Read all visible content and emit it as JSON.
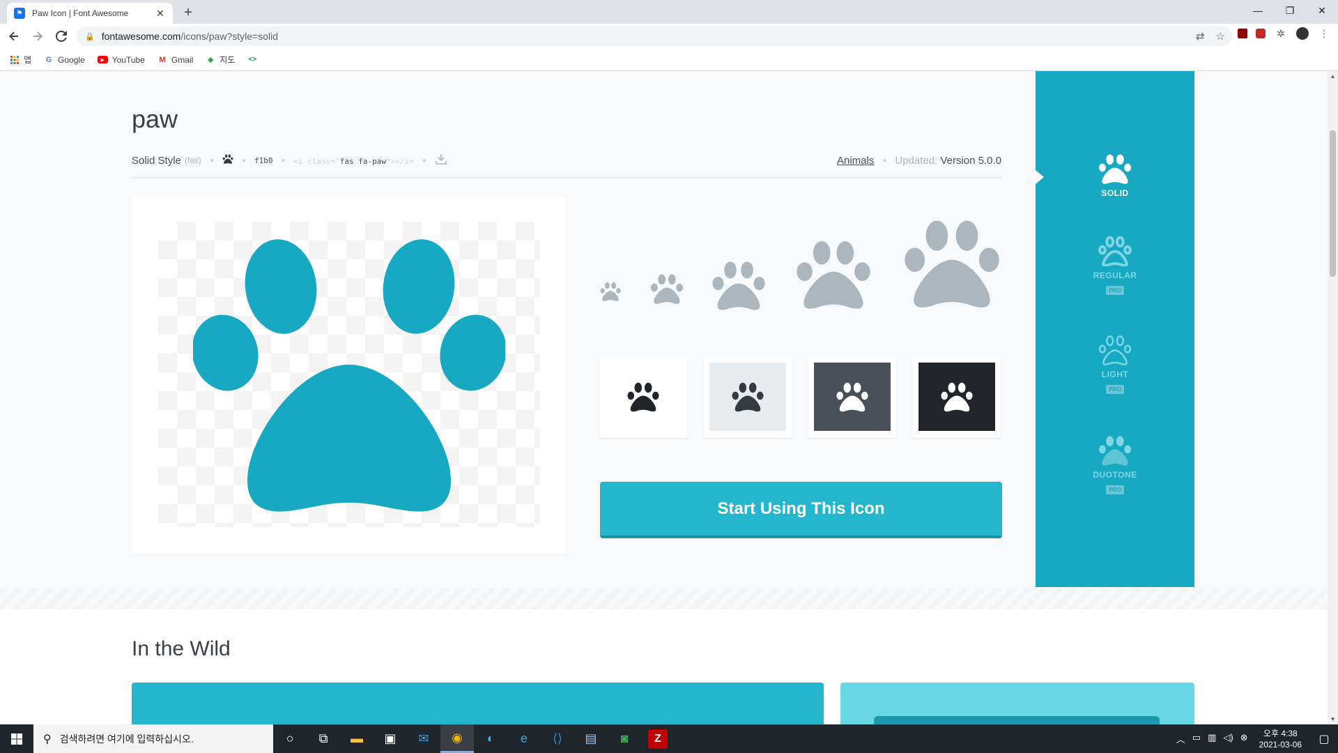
{
  "browser": {
    "tab_title": "Paw Icon | Font Awesome",
    "tab_close": "✕",
    "new_tab": "+",
    "url_host": "fontawesome.com",
    "url_path": "/icons/paw?style=solid",
    "window_controls": {
      "minimize": "—",
      "restore": "❐",
      "close": "✕"
    }
  },
  "bookmarks": [
    {
      "label": "앱",
      "icon": "apps-grid-icon"
    },
    {
      "label": "Google",
      "icon": "google-icon"
    },
    {
      "label": "YouTube",
      "icon": "youtube-icon"
    },
    {
      "label": "Gmail",
      "icon": "gmail-icon"
    },
    {
      "label": "지도",
      "icon": "maps-icon"
    },
    {
      "label": "",
      "icon": "code-icon"
    }
  ],
  "icon_page": {
    "name": "paw",
    "style_label": "Solid Style",
    "style_prefix": "(fas)",
    "unicode": "f1b0",
    "code_open": "<i class=\"",
    "code_class": "fas fa-paw",
    "code_close": "\"></i>",
    "category": "Animals",
    "updated_label": "Updated:",
    "version": "Version 5.0.0",
    "start_button": "Start Using This Icon"
  },
  "styles": [
    {
      "label": "SOLID",
      "selected": true,
      "pro": false
    },
    {
      "label": "REGULAR",
      "selected": false,
      "pro": true
    },
    {
      "label": "LIGHT",
      "selected": false,
      "pro": true
    },
    {
      "label": "DUOTONE",
      "selected": false,
      "pro": true
    }
  ],
  "pro_badge": "PRO",
  "wild": {
    "title": "In the Wild"
  },
  "colors": {
    "accent": "#17a9c1",
    "button": "#23b6cd",
    "paw_preview": "#17a9c1",
    "paw_sizes": "#adb5bd"
  },
  "taskbar": {
    "search_placeholder": "검색하려면 여기에 입력하십시오.",
    "time": "오후 4:38",
    "date": "2021-03-06",
    "apps": [
      "cortana-icon",
      "task-view-icon",
      "file-explorer-icon",
      "store-icon",
      "mail-icon",
      "chrome-icon",
      "edge-icon",
      "ie-icon",
      "vscode-icon",
      "notepad-icon",
      "terminal-icon",
      "filezilla-icon"
    ]
  }
}
